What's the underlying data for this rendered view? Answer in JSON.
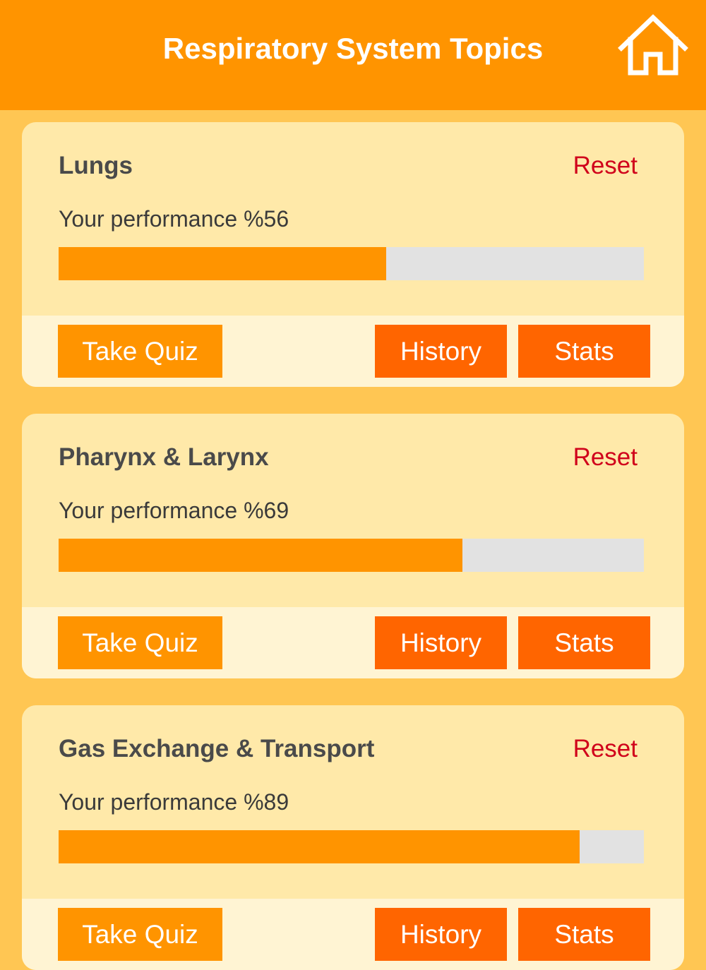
{
  "header": {
    "title": "Respiratory System Topics",
    "home_icon": "home-icon"
  },
  "colors": {
    "header": "#FF9400",
    "background": "#FFC653",
    "card": "#FFE9A9",
    "card_footer": "#FFF4D3",
    "progress_fill": "#FF9400",
    "progress_track": "#E2E2E2",
    "reset": "#D0021B",
    "take_quiz": "#FF9400",
    "history_stats": "#FF6500"
  },
  "topics": [
    {
      "title": "Lungs",
      "reset_label": "Reset",
      "performance_label": "Your performance %56",
      "performance_percent": 56,
      "take_quiz_label": "Take Quiz",
      "history_label": "History",
      "stats_label": "Stats"
    },
    {
      "title": "Pharynx & Larynx",
      "reset_label": "Reset",
      "performance_label": "Your performance %69",
      "performance_percent": 69,
      "take_quiz_label": "Take Quiz",
      "history_label": "History",
      "stats_label": "Stats"
    },
    {
      "title": "Gas Exchange & Transport",
      "reset_label": "Reset",
      "performance_label": "Your performance %89",
      "performance_percent": 89,
      "take_quiz_label": "Take Quiz",
      "history_label": "History",
      "stats_label": "Stats"
    }
  ]
}
